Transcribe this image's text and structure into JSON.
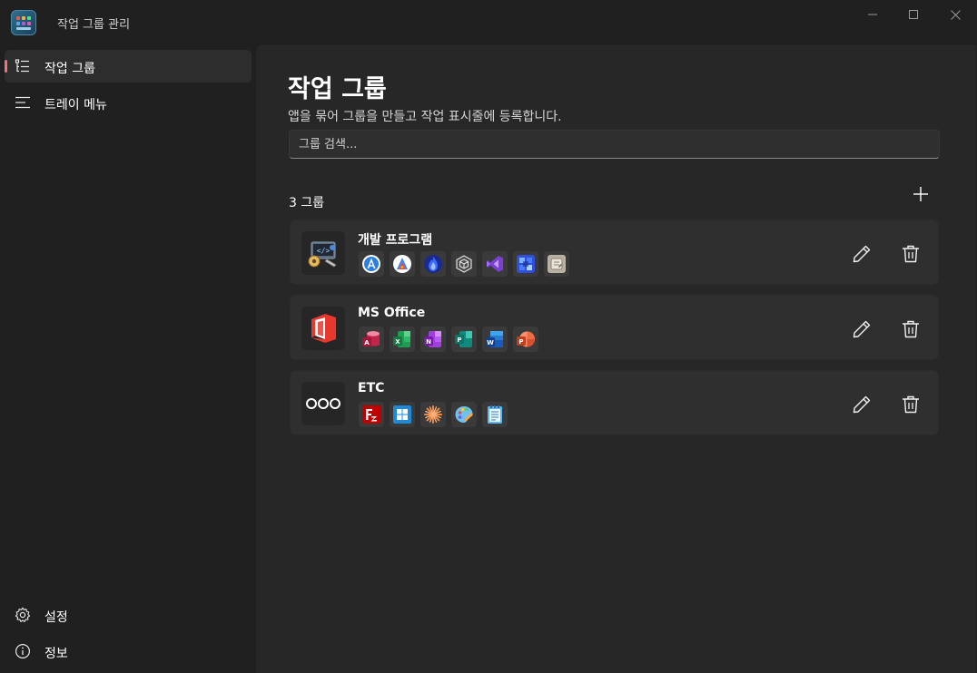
{
  "window": {
    "title": "작업 그룹 관리",
    "icons": {
      "minimize": "minimize-icon",
      "maximize": "maximize-icon",
      "close": "close-icon"
    }
  },
  "sidebar": {
    "items": [
      {
        "label": "작업 그룹",
        "icon": "list-icon",
        "selected": true
      },
      {
        "label": "트레이 메뉴",
        "icon": "lines-icon",
        "selected": false
      }
    ],
    "footer": [
      {
        "label": "설정",
        "icon": "gear-icon"
      },
      {
        "label": "정보",
        "icon": "info-icon"
      }
    ]
  },
  "main": {
    "title": "작업 그룹",
    "subtitle": "앱을 묶어 그룹을 만들고 작업 표시줄에 등록합니다.",
    "search": {
      "placeholder": "그룹 검색...",
      "value": ""
    },
    "count_label": "3 그룹",
    "add_icon": "plus-icon",
    "groups": [
      {
        "name": "개발 프로그램",
        "apps": [
          "android-studio-icon",
          "app-icon-2",
          "flame-icon",
          "unity-icon",
          "visual-studio-icon",
          "grid-app-icon",
          "app-icon-7"
        ]
      },
      {
        "name": "MS Office",
        "apps": [
          "access-icon",
          "excel-icon",
          "onenote-icon",
          "publisher-icon",
          "word-icon",
          "powerpoint-icon"
        ]
      },
      {
        "name": "ETC",
        "apps": [
          "filezilla-icon",
          "windows-icon",
          "asterisk-icon",
          "paint-icon",
          "notepad-icon"
        ]
      }
    ]
  },
  "colors": {
    "accent": "#f0747a",
    "background": "#202020",
    "content": "#272727",
    "card": "#2f2f2f"
  }
}
